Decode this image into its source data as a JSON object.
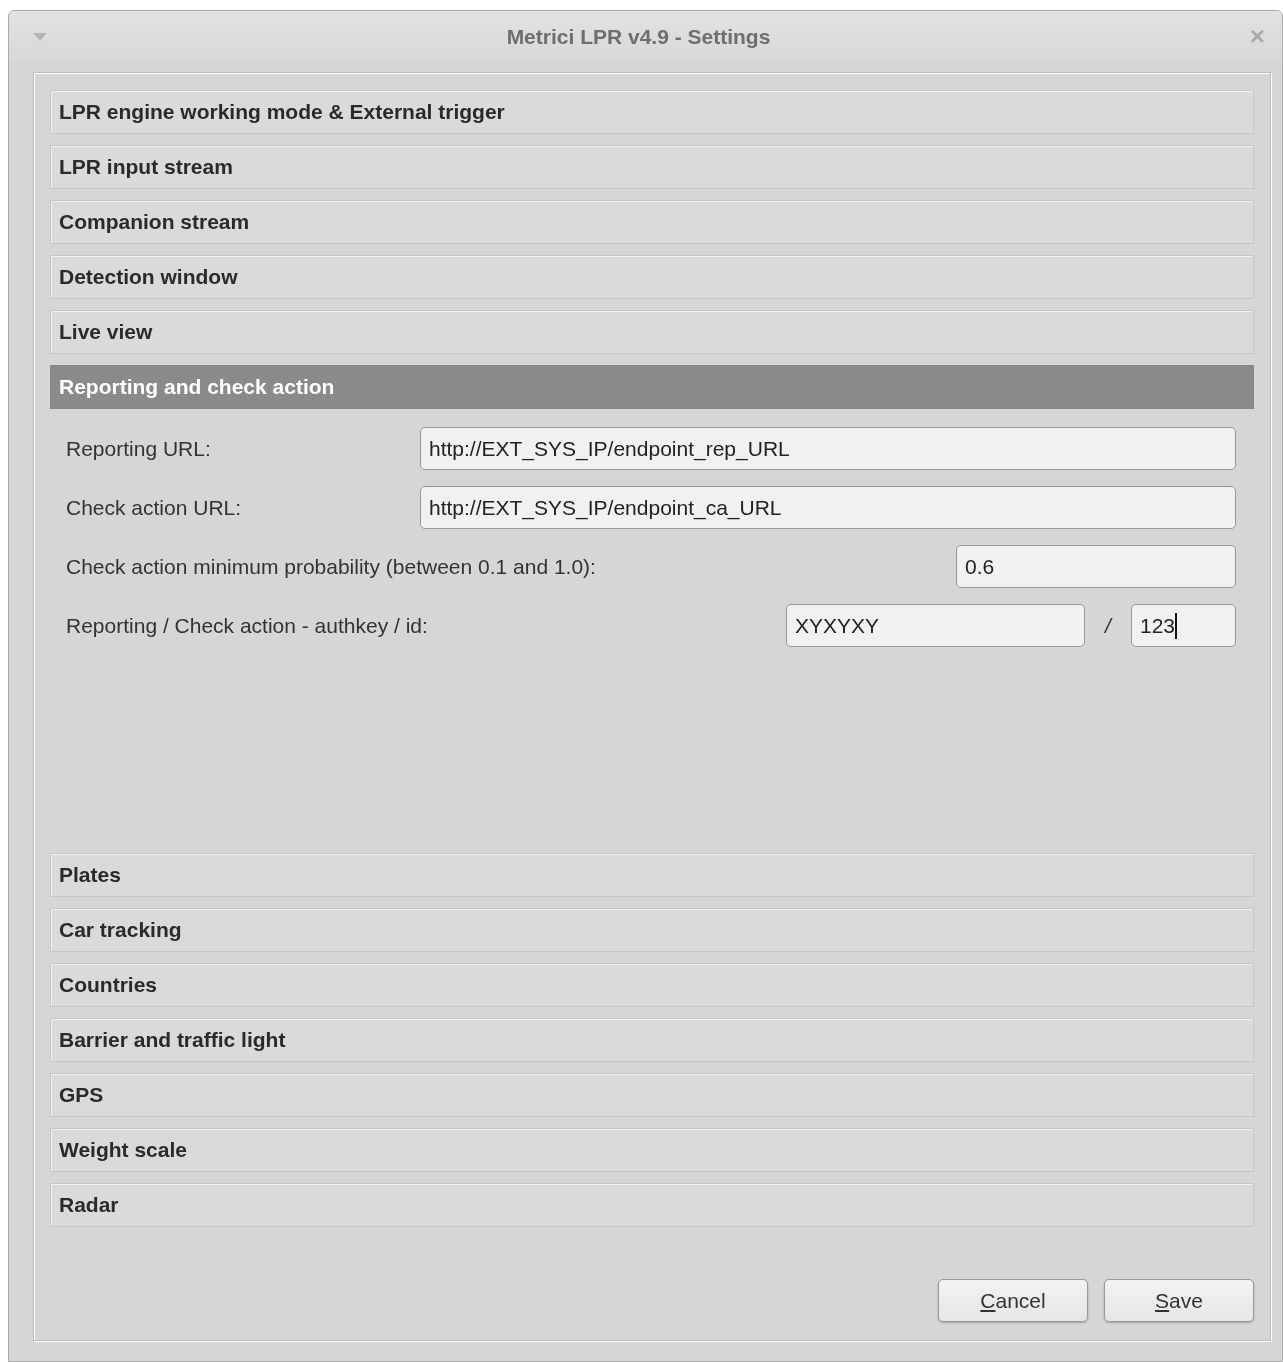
{
  "window": {
    "title": "Metrici LPR v4.9 - Settings",
    "close": "×"
  },
  "sections": [
    {
      "title": "LPR engine working mode & External trigger",
      "selected": false
    },
    {
      "title": "LPR input stream",
      "selected": false
    },
    {
      "title": "Companion stream",
      "selected": false
    },
    {
      "title": "Detection window",
      "selected": false
    },
    {
      "title": "Live view",
      "selected": false
    },
    {
      "title": "Reporting and check action",
      "selected": true,
      "fields": [
        {
          "kind": "wide",
          "label": "Reporting URL:",
          "value": "http://EXT_SYS_IP/endpoint_rep_URL"
        },
        {
          "kind": "wide",
          "label": "Check action URL:",
          "value": "http://EXT_SYS_IP/endpoint_ca_URL"
        },
        {
          "kind": "short",
          "label": "Check action minimum probability (between 0.1 and 1.0):",
          "value": "0.6"
        },
        {
          "kind": "pair",
          "label": "Reporting / Check action - authkey / id:",
          "value": "XYXYXY",
          "separator": "/",
          "value_2": "123",
          "focused": true
        }
      ]
    },
    {
      "title": "Plates",
      "selected": false
    },
    {
      "title": "Car tracking",
      "selected": false
    },
    {
      "title": "Countries",
      "selected": false
    },
    {
      "title": "Barrier and traffic light",
      "selected": false
    },
    {
      "title": "GPS",
      "selected": false
    },
    {
      "title": "Weight scale",
      "selected": false
    },
    {
      "title": "Radar",
      "selected": false
    }
  ],
  "buttons": [
    {
      "label": "Cancel",
      "mnemonic_underlined": true
    },
    {
      "label": "Save",
      "mnemonic_underlined": true
    }
  ]
}
